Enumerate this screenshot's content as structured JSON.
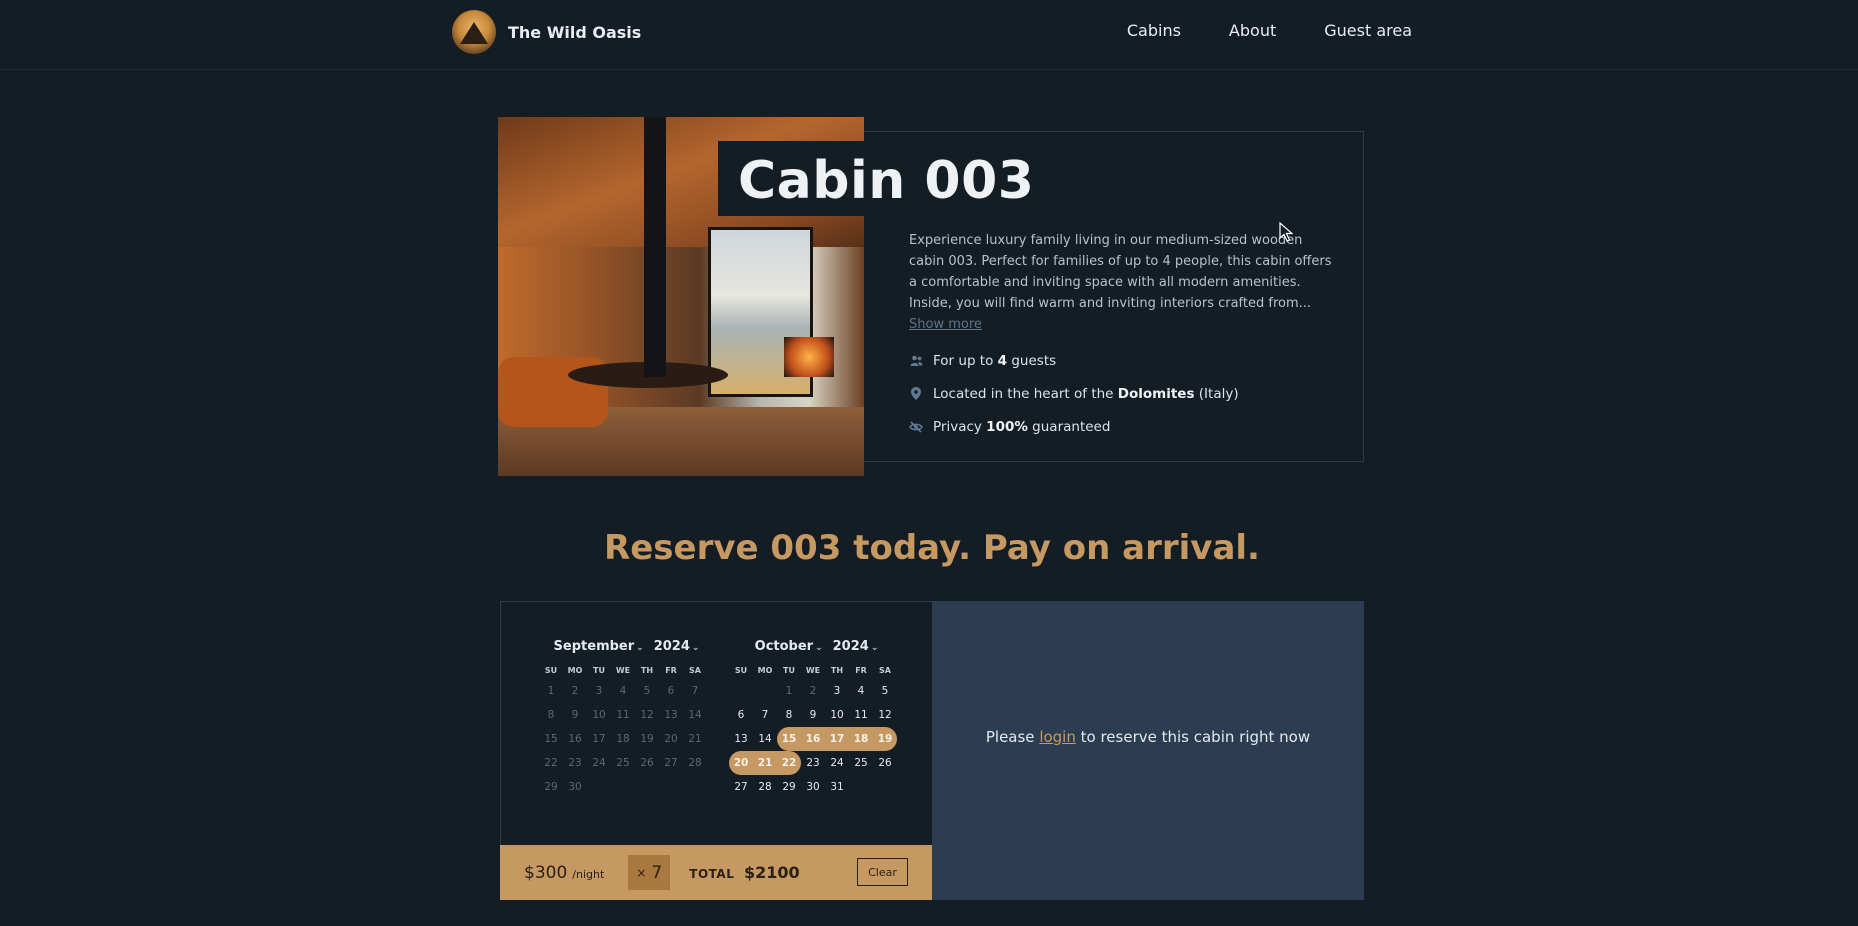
{
  "header": {
    "logo_alt": "The Wild Oasis logo",
    "brand": "The Wild Oasis",
    "nav": [
      {
        "label": "Cabins"
      },
      {
        "label": "About"
      },
      {
        "label": "Guest area"
      }
    ]
  },
  "cabin": {
    "title": "Cabin 003",
    "description": "Experience luxury family living in our medium-sized wooden cabin 003. Perfect for families of up to 4 people, this cabin offers a comfortable and inviting space with all modern amenities. Inside, you will find warm and inviting interiors crafted from...",
    "show_more": "Show more",
    "features": {
      "guests_pre": "For up to ",
      "guests_num": "4",
      "guests_post": " guests",
      "location_pre": "Located in the heart of the ",
      "location_bold": "Dolomites",
      "location_post": " (Italy)",
      "privacy_pre": "Privacy ",
      "privacy_bold": "100%",
      "privacy_post": " guaranteed"
    },
    "icons": {
      "guests": "users-icon",
      "location": "map-pin-icon",
      "privacy": "eye-slash-icon"
    }
  },
  "reserve_heading": "Reserve 003 today. Pay on arrival.",
  "calendar": {
    "weekdays": [
      "SU",
      "MO",
      "TU",
      "WE",
      "TH",
      "FR",
      "SA"
    ],
    "months": [
      {
        "month": "September",
        "year": "2024",
        "weeks": [
          [
            "1",
            "2",
            "3",
            "4",
            "5",
            "6",
            "7"
          ],
          [
            "8",
            "9",
            "10",
            "11",
            "12",
            "13",
            "14"
          ],
          [
            "15",
            "16",
            "17",
            "18",
            "19",
            "20",
            "21"
          ],
          [
            "22",
            "23",
            "24",
            "25",
            "26",
            "27",
            "28"
          ],
          [
            "29",
            "30",
            "",
            "",
            "",
            "",
            ""
          ]
        ]
      },
      {
        "month": "October",
        "year": "2024",
        "weeks": [
          [
            "",
            "",
            "1",
            "2",
            "3",
            "4",
            "5"
          ],
          [
            "6",
            "7",
            "8",
            "9",
            "10",
            "11",
            "12"
          ],
          [
            "13",
            "14",
            "15",
            "16",
            "17",
            "18",
            "19"
          ],
          [
            "20",
            "21",
            "22",
            "23",
            "24",
            "25",
            "26"
          ],
          [
            "27",
            "28",
            "29",
            "30",
            "31",
            "",
            ""
          ]
        ]
      }
    ],
    "selected_range": {
      "start": "October 15, 2024",
      "end": "October 22, 2024"
    }
  },
  "pricing": {
    "price": "$300",
    "per_night": "/night",
    "nights_prefix": "×",
    "nights": "7",
    "total_label": "TOTAL",
    "total": "$2100",
    "clear": "Clear"
  },
  "login": {
    "pre": "Please ",
    "link": "login",
    "post": " to reserve this cabin right now"
  },
  "colors": {
    "background": "#141c24",
    "accent": "#c69963",
    "panel": "#2c3d51",
    "text": "#d4dee7"
  }
}
